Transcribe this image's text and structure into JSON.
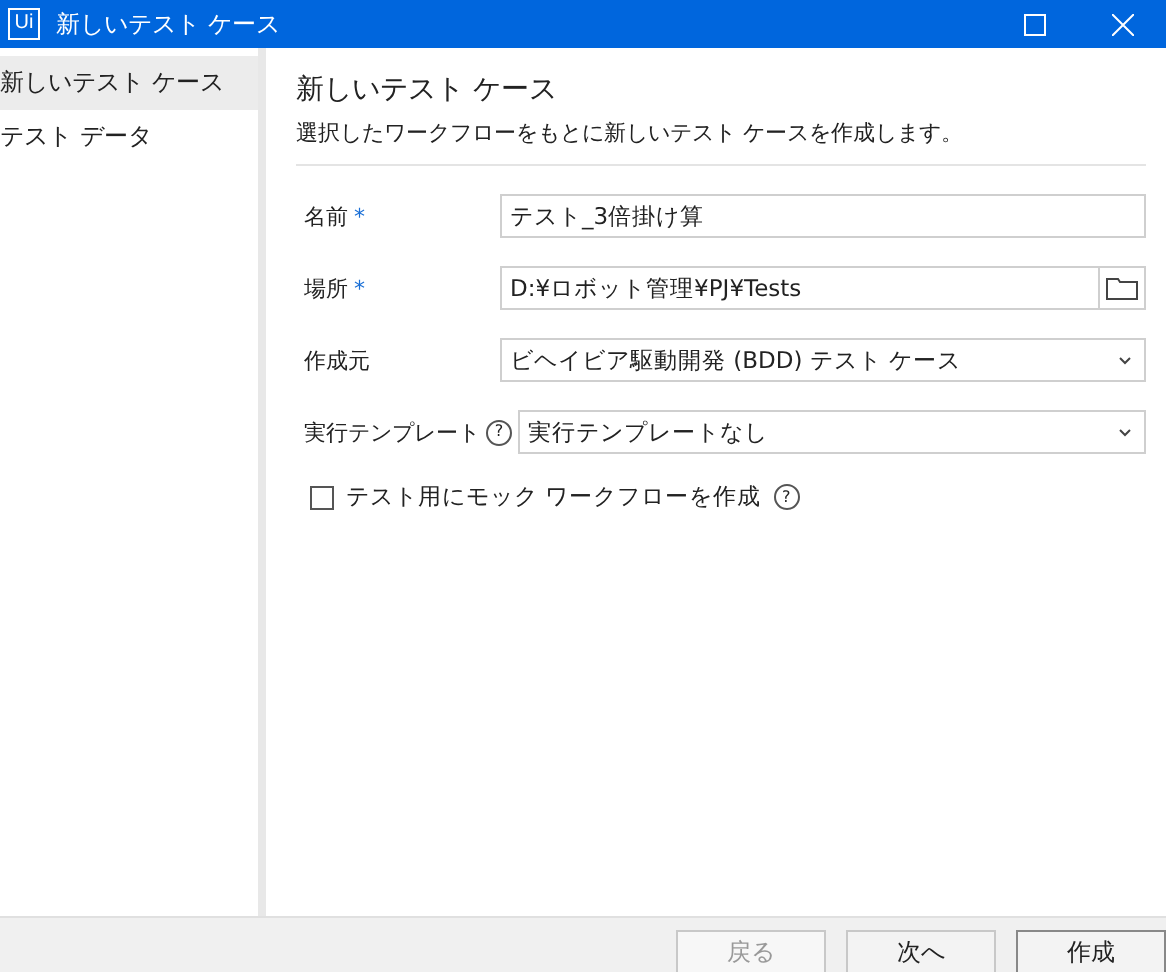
{
  "window": {
    "logo": "Ui",
    "title": "新しいテスト ケース"
  },
  "sidebar": {
    "items": [
      {
        "label": "新しいテスト ケース",
        "selected": true
      },
      {
        "label": "テスト データ",
        "selected": false
      }
    ]
  },
  "header": {
    "title": "新しいテスト ケース",
    "description": "選択したワークフローをもとに新しいテスト ケースを作成します。"
  },
  "fields": [
    {
      "kind": "text",
      "label": "名前",
      "required_mark": "*",
      "value": "テスト_3倍掛け算"
    },
    {
      "kind": "folder",
      "label": "場所",
      "required_mark": "*",
      "value": "D:¥ロボット管理¥PJ¥Tests"
    },
    {
      "kind": "dropdown",
      "label": "作成元",
      "value": "ビヘイビア駆動開発 (BDD) テスト ケース"
    },
    {
      "kind": "dropdown",
      "label": "実行テンプレート",
      "help": "?",
      "value": "実行テンプレートなし"
    }
  ],
  "mock_option": {
    "label": "テスト用にモック ワークフローを作成",
    "help": "?",
    "checked": false
  },
  "buttons": [
    {
      "label": "戻る",
      "disabled": true
    },
    {
      "label": "次へ",
      "disabled": false
    },
    {
      "label": "作成",
      "disabled": false
    }
  ]
}
